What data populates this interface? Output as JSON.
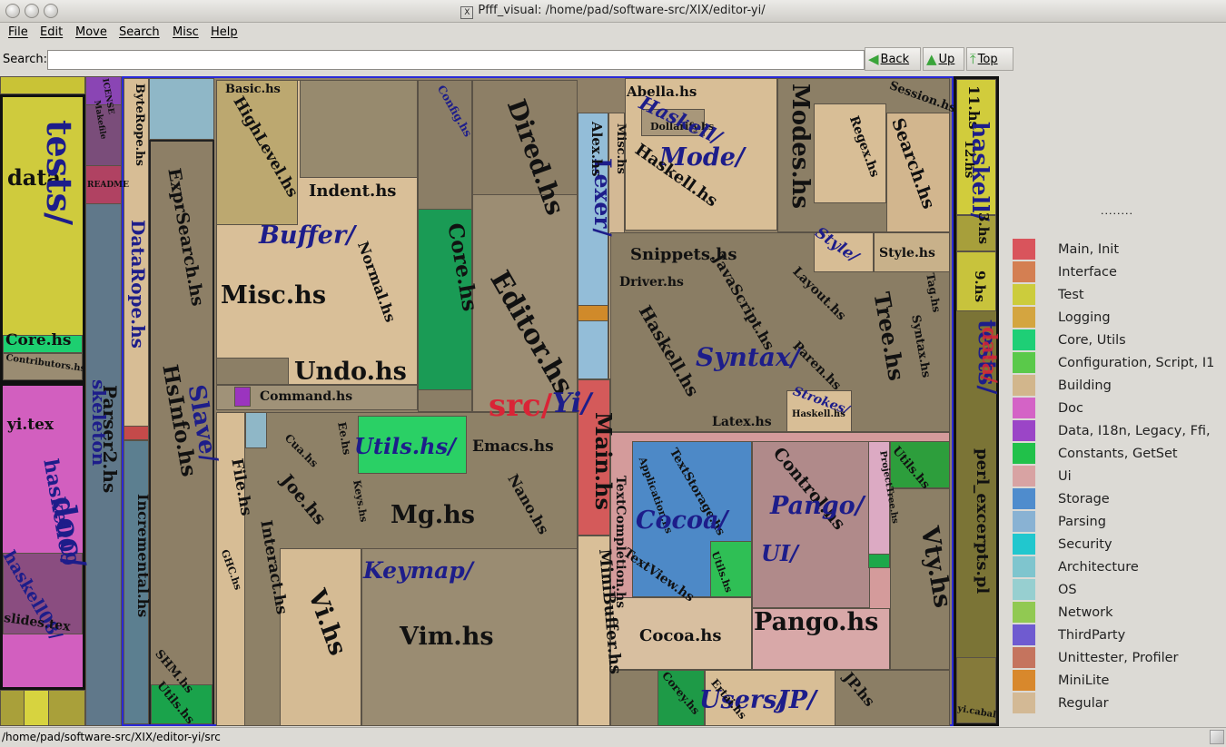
{
  "window": {
    "title": "Pfff_visual: /home/pad/software-src/XIX/editor-yi/",
    "x_icon": "X"
  },
  "menu": [
    "File",
    "Edit",
    "Move",
    "Search",
    "Misc",
    "Help"
  ],
  "search": {
    "label": "Search:",
    "value": "",
    "placeholder": ""
  },
  "nav": {
    "back": "Back",
    "up": "Up",
    "top": "Top"
  },
  "nav_icons": {
    "back": "arrow-left-icon",
    "up": "arrow-up-icon",
    "top": "arrow-top-icon"
  },
  "treemap_labels": {
    "data": "data",
    "tests": "tests/",
    "core": "Core.hs",
    "contributors": "Contributors.hs",
    "yitex": "yi.tex",
    "haskell09": "haskell09",
    "doc": "doc/",
    "haskell08": "haskell08/",
    "slides": "slides.tex",
    "readme": "README",
    "makefile": "Makefile",
    "icense": "ICENSE",
    "parser2": "Parser2.hs",
    "skeleton": "skeleton",
    "bytesrope": "ByteRope.hs",
    "datarope": "DataRope.hs",
    "exprsearch": "ExprSearch.hs",
    "hsinfo": "HsInfo.hs",
    "slave": "Slave/",
    "incremental": "Incremental.hs",
    "shm": "SHM.hs",
    "utils_left": "Utils.hs",
    "basic": "Basic.hs",
    "highlevel": "HighLevel.hs",
    "indent": "Indent.hs",
    "buffer": "Buffer/",
    "misc": "Misc.hs",
    "normal": "Normal.hs",
    "undo": "Undo.hs",
    "command": "Command.hs",
    "dired": "Dired.hs",
    "corelib": "Core.hs",
    "editor": "Editor.hs",
    "config": "Config.hs",
    "lexer": "Lexer/",
    "alex": "Alex.hs",
    "mischs": "Misc.hs",
    "abella": "Abella.hs",
    "dollarify": "Dollarify.hs",
    "haskellmode": "Haskell/",
    "mode": "Mode/",
    "haskell_mode_file": "Haskell.hs",
    "modes": "Modes.hs",
    "regex": "Regex.hs",
    "search": "Search.hs",
    "session": "Session.hs",
    "snippets": "Snippets.hs",
    "style_dir": "Style/",
    "style": "Style.hs",
    "driver": "Driver.hs",
    "javascript": "JavaScript.hs",
    "layout": "Layout.hs",
    "tree": "Tree.hs",
    "tag": "Tag.hs",
    "syntaxhs": "Syntax.hs",
    "haskell_syn": "Haskell.hs",
    "syntax": "Syntax/",
    "paren": "Paren.hs",
    "strokes": "Strokes/",
    "haskell_small": "Haskell.hs",
    "latex": "Latex.hs",
    "src": "src/",
    "yi": "Yi/",
    "mainhs": "Main.hs",
    "file": "File.hs",
    "cua": "Cua.hs",
    "ee": "Ee.hs",
    "utils_dir": "Utils.hs/",
    "emacs": "Emacs.hs",
    "joe": "Joe.hs",
    "keys": "Keys.hs",
    "mg": "Mg.hs",
    "nano": "Nano.hs",
    "ghc": "GHC.hs",
    "interact": "Interact.hs",
    "keymap": "Keymap/",
    "vi": "Vi.hs",
    "vim": "Vim.hs",
    "textcompletion": "TextCompletion.hs",
    "minibuffer": "MiniBuffer.hs",
    "application": "Application.hs",
    "textstorage": "TextStorage.hs",
    "cocoa_dir": "Cocoa/",
    "control": "Control.hs",
    "pango_dir": "Pango/",
    "ui": "UI/",
    "projecttree": "ProjectTree.hs",
    "utils_ui": "Utils.hs",
    "textview": "TextView.hs",
    "utilshs": "Utils.hs",
    "cocoa": "Cocoa.hs",
    "pango": "Pango.hs",
    "vty": "Vty.hs",
    "users": "Users/",
    "jp": "JP/",
    "corey": "Corey.hs",
    "ertai": "Ertai.hs",
    "jphs": "JP.hs",
    "r11": "11.hs",
    "r12": "12.hs",
    "r3": "3.hs",
    "haskell_r": "haskell/",
    "r9": "9.hs",
    "tests_r": "tests/",
    "data_r": "data/",
    "perl": "perl_excerpts.pl",
    "cabal": "yi.cabal"
  },
  "legend": {
    "dots": "........",
    "items": [
      {
        "label": "Main, Init",
        "color": "#d9545c"
      },
      {
        "label": "Interface",
        "color": "#d47f52"
      },
      {
        "label": "Test",
        "color": "#cccc3c"
      },
      {
        "label": "Logging",
        "color": "#d4a540"
      },
      {
        "label": "Core, Utils",
        "color": "#1ecf76"
      },
      {
        "label": "Configuration, Script, I1",
        "color": "#5ac94a"
      },
      {
        "label": "Building",
        "color": "#d2b68c"
      },
      {
        "label": "Doc",
        "color": "#d463c6"
      },
      {
        "label": "Data, I18n, Legacy, Ffi,",
        "color": "#9b45c7"
      },
      {
        "label": "Constants, GetSet",
        "color": "#21c14a"
      },
      {
        "label": "Ui",
        "color": "#d8a3a3"
      },
      {
        "label": "Storage",
        "color": "#4f8ccd"
      },
      {
        "label": "Parsing",
        "color": "#89b2d3"
      },
      {
        "label": "Security",
        "color": "#21c7ce"
      },
      {
        "label": "Architecture",
        "color": "#7fc5ce"
      },
      {
        "label": "OS",
        "color": "#97cfd0"
      },
      {
        "label": "Network",
        "color": "#91c952"
      },
      {
        "label": "ThirdParty",
        "color": "#6f5bd0"
      },
      {
        "label": "Unittester, Profiler",
        "color": "#c5745e"
      },
      {
        "label": "MiniLite",
        "color": "#d8882c"
      },
      {
        "label": "Regular",
        "color": "#d3b995"
      }
    ]
  },
  "status": "/home/pad/software-src/XIX/editor-yi/src"
}
